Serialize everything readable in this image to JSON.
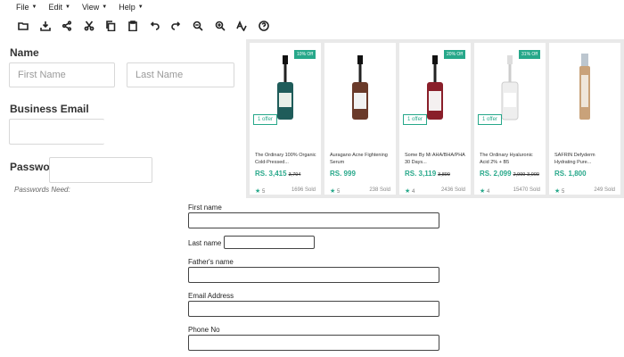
{
  "menu": [
    "File",
    "Edit",
    "View",
    "Help"
  ],
  "toolbar": [
    {
      "name": "open-folder-icon"
    },
    {
      "name": "download-icon"
    },
    {
      "name": "share-icon"
    },
    {
      "name": "cut-icon"
    },
    {
      "name": "copy-icon"
    },
    {
      "name": "paste-icon"
    },
    {
      "name": "undo-icon"
    },
    {
      "name": "redo-icon"
    },
    {
      "name": "zoom-out-icon"
    },
    {
      "name": "zoom-in-icon"
    },
    {
      "name": "spellcheck-icon"
    },
    {
      "name": "help-icon"
    }
  ],
  "signup": {
    "name_label": "Name",
    "first_placeholder": "First Name",
    "last_placeholder": "Last Name",
    "email_label": "Business Email",
    "password_label": "Password",
    "password_hint": "Passwords Need:"
  },
  "products": [
    {
      "badge": "10% Off",
      "offer": "1 offer",
      "name": "The Ordinary 100% Organic Cold-Pressed...",
      "price": "RS. 3,415",
      "old": "3,794",
      "rating": "5",
      "sold": "1696 Sold",
      "color": "#1f5c5a"
    },
    {
      "badge": "",
      "offer": "",
      "name": "Auragano Acne Fightening Serum",
      "price": "RS. 999",
      "old": "",
      "rating": "5",
      "sold": "238 Sold",
      "color": "#6a3a2a"
    },
    {
      "badge": "20% Off",
      "offer": "1 offer",
      "name": "Some By Mi AHA/BHA/PHA 30 Days...",
      "price": "RS. 3,119",
      "old": "3,899",
      "rating": "4",
      "sold": "2436 Sold",
      "color": "#8a1f2a"
    },
    {
      "badge": "31% Off",
      "offer": "1 offer",
      "name": "The Ordinary Hyaluronic Acid 2% + B5",
      "price": "RS. 2,099",
      "old": "2,999-3,000",
      "rating": "4",
      "sold": "15470 Sold",
      "color": "#e8e8e8"
    },
    {
      "badge": "",
      "offer": "",
      "name": "SAFRIN Defyderm Hydrating Pure...",
      "price": "RS. 1,800",
      "old": "",
      "rating": "5",
      "sold": "249 Sold",
      "color": "#c9a27a"
    }
  ],
  "form": {
    "first_name": "First name",
    "last_name": "Last name",
    "fathers_name": "Father's name",
    "email": "Email Address",
    "phone": "Phone No"
  }
}
